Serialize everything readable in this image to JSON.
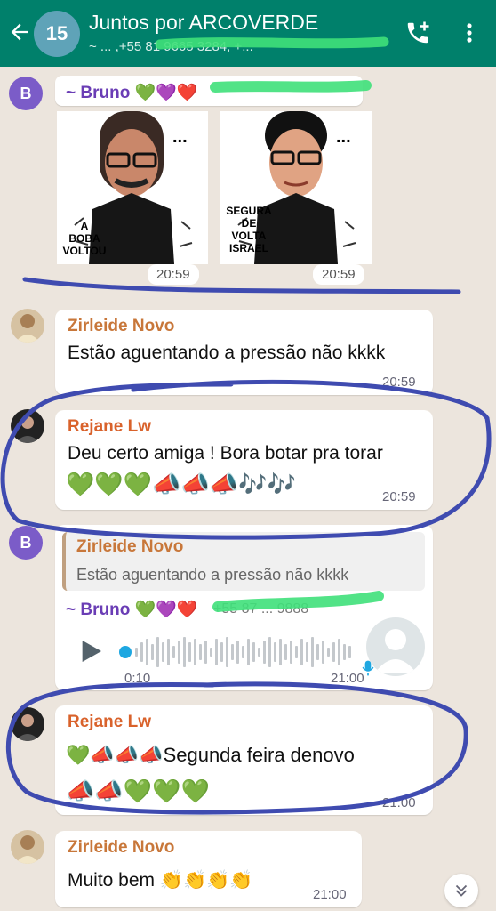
{
  "header": {
    "title": "Juntos por ARCOVERDE",
    "subtitle": "~ ... ,+55 81 9665 3284, +...",
    "avatar_text": "15"
  },
  "messages": {
    "m1": {
      "sender_avatar": "B",
      "sender": "~ Bruno 💚💜❤️",
      "sticker1_caption": "A\nBOBA\nVOLTOU",
      "sticker2_caption": "SEGURA\nDE\nVOLTA\nISRAEL",
      "sticker1_dots": "...",
      "sticker2_dots": "...",
      "time1": "20:59",
      "time2": "20:59"
    },
    "m2": {
      "sender": "Zirleide Novo",
      "text": "Estão aguentando a pressão não kkkk",
      "time": "20:59"
    },
    "m3": {
      "sender": "Rejane Lw",
      "text": "Deu certo amiga ! Bora botar pra torar",
      "emojis": "💚💚💚📣📣📣🎶🎶",
      "time": "20:59"
    },
    "m4": {
      "sender_avatar": "B",
      "quote_sender": "Zirleide Novo",
      "quote_text": "Estão aguentando a pressão não kkkk",
      "sender": "~ Bruno 💚💜❤️",
      "sender_phone": "+55 87 ... 9888",
      "duration": "0:10",
      "time": "21:00"
    },
    "m5": {
      "sender": "Rejane Lw",
      "line1": "💚📣📣📣Segunda feira denovo",
      "line2": "📣📣💚💚💚",
      "time": "21:00"
    },
    "m6": {
      "sender": "Zirleide Novo",
      "text": "Muito bem 👏👏👏👏",
      "time": "21:00"
    }
  },
  "colors": {
    "header": "#00806B",
    "chat_background": "#ECE5DD",
    "sender_bruno": "#6A3DB5",
    "sender_zirleide": "#C8773A",
    "sender_rejane": "#D9622B",
    "annotation_ink": "#3F4BB0"
  }
}
